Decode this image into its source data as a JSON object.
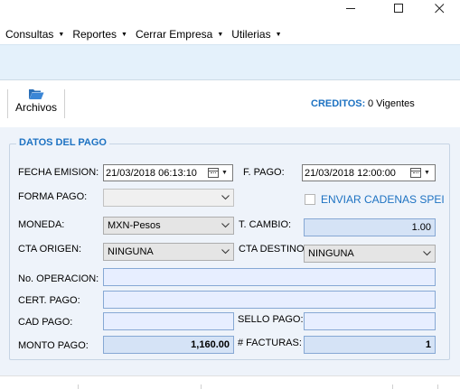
{
  "menu": [
    {
      "label": "Consultas"
    },
    {
      "label": "Reportes"
    },
    {
      "label": "Cerrar Empresa"
    },
    {
      "label": "Utilerias"
    }
  ],
  "toolbar": {
    "archivos_label": "Archivos",
    "creditos_label": "CREDITOS:",
    "creditos_value": "0 Vigentes"
  },
  "form": {
    "group_title": "DATOS DEL PAGO",
    "fecha_emision_label": "FECHA EMISION:",
    "fecha_emision_value": "21/03/2018 06:13:10",
    "f_pago_label": "F. PAGO:",
    "f_pago_value": "21/03/2018 12:00:00",
    "forma_pago_label": "FORMA PAGO:",
    "forma_pago_value": "",
    "enviar_spei_label": "ENVIAR CADENAS SPEI",
    "enviar_spei_checked": false,
    "moneda_label": "MONEDA:",
    "moneda_value": "MXN-Pesos",
    "t_cambio_label": "T. CAMBIO:",
    "t_cambio_value": "1.00",
    "cta_origen_label": "CTA ORIGEN:",
    "cta_origen_value": "NINGUNA",
    "cta_destino_label": "CTA DESTINO:",
    "cta_destino_value": "NINGUNA",
    "no_operacion_label": "No. OPERACION:",
    "no_operacion_value": "",
    "cert_pago_label": "CERT. PAGO:",
    "cert_pago_value": "",
    "cad_pago_label": "CAD PAGO:",
    "cad_pago_value": "",
    "sello_pago_label": "SELLO PAGO:",
    "sello_pago_value": "",
    "monto_pago_label": "MONTO PAGO:",
    "monto_pago_value": "1,160.00",
    "num_facturas_label": "# FACTURAS:",
    "num_facturas_value": "1"
  },
  "colors": {
    "accent": "#1d72c2",
    "band": "#e4f1fb",
    "panel": "#eef3fa",
    "input_fill": "#e7eeff"
  },
  "icons": [
    "minimize-icon",
    "maximize-icon",
    "close-icon",
    "folder-open-icon",
    "calendar-icon",
    "chevron-down-icon"
  ]
}
